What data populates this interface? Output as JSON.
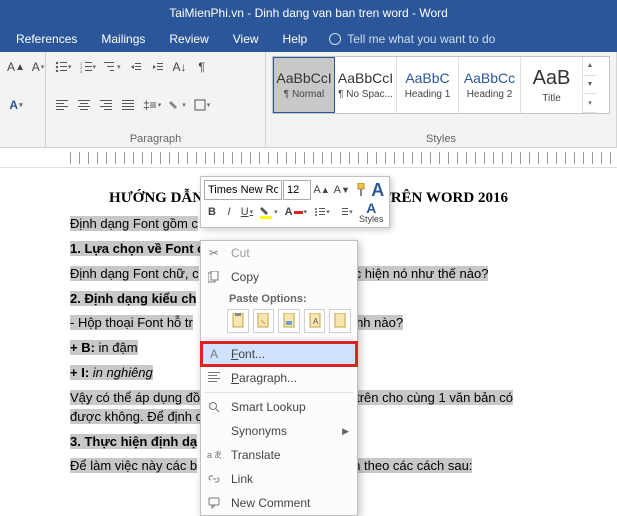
{
  "title_bar": "TaiMienPhi.vn - Dinh dang van ban tren word  -  Word",
  "menu": {
    "references": "References",
    "mailings": "Mailings",
    "review": "Review",
    "view": "View",
    "help": "Help",
    "tellme": "Tell me what you want to do"
  },
  "ribbon": {
    "paragraph_label": "Paragraph",
    "styles_label": "Styles",
    "styles": [
      {
        "sample": "AaBbCcI",
        "name": "¶ Normal"
      },
      {
        "sample": "AaBbCcI",
        "name": "¶ No Spac..."
      },
      {
        "sample": "AaBbC",
        "name": "Heading 1"
      },
      {
        "sample": "AaBbCc",
        "name": "Heading 2"
      },
      {
        "sample": "AaB",
        "name": "Title"
      }
    ]
  },
  "mini": {
    "font": "Times New Ro",
    "size": "12",
    "b": "B",
    "i": "I",
    "u": "U",
    "styles": "Styles"
  },
  "ctx": {
    "cut": "Cut",
    "copy": "Copy",
    "paste_options": "Paste Options:",
    "font": "Font...",
    "paragraph": "Paragraph...",
    "smart": "Smart Lookup",
    "syn": "Synonyms",
    "trans": "Translate",
    "link": "Link",
    "comment": "New Comment"
  },
  "doc": {
    "title": "HƯỚNG DẪN ĐỊNH DẠNG FONT CHỮ TRÊN WORD 2016",
    "p1": "Định dạng Font gồm c",
    "p2a": "1. Lựa chọn về Font c",
    "p3a": "Định dạng Font chữ, c",
    "p3b": "c hiện nó như thế nào?",
    "p4": "2. Định dạng kiểu ch",
    "p5a": "- Hộp thoại Font hỗ tr",
    "p5b": "ành nào?",
    "p6a": "+ B:",
    "p6b": " in đậm",
    "p7a": "+ I:",
    "p7b": " in nghiêng",
    "p8a": "Vậy có thể áp dụng đồ",
    "p8b": "trên cho cùng 1 văn bản có được không. Để định dạng thì sẽ phải t",
    "p9": "3. Thực hiện định dạ",
    "p10a": "Để làm việc này các b",
    "p10b": "n theo các cách sau:"
  }
}
